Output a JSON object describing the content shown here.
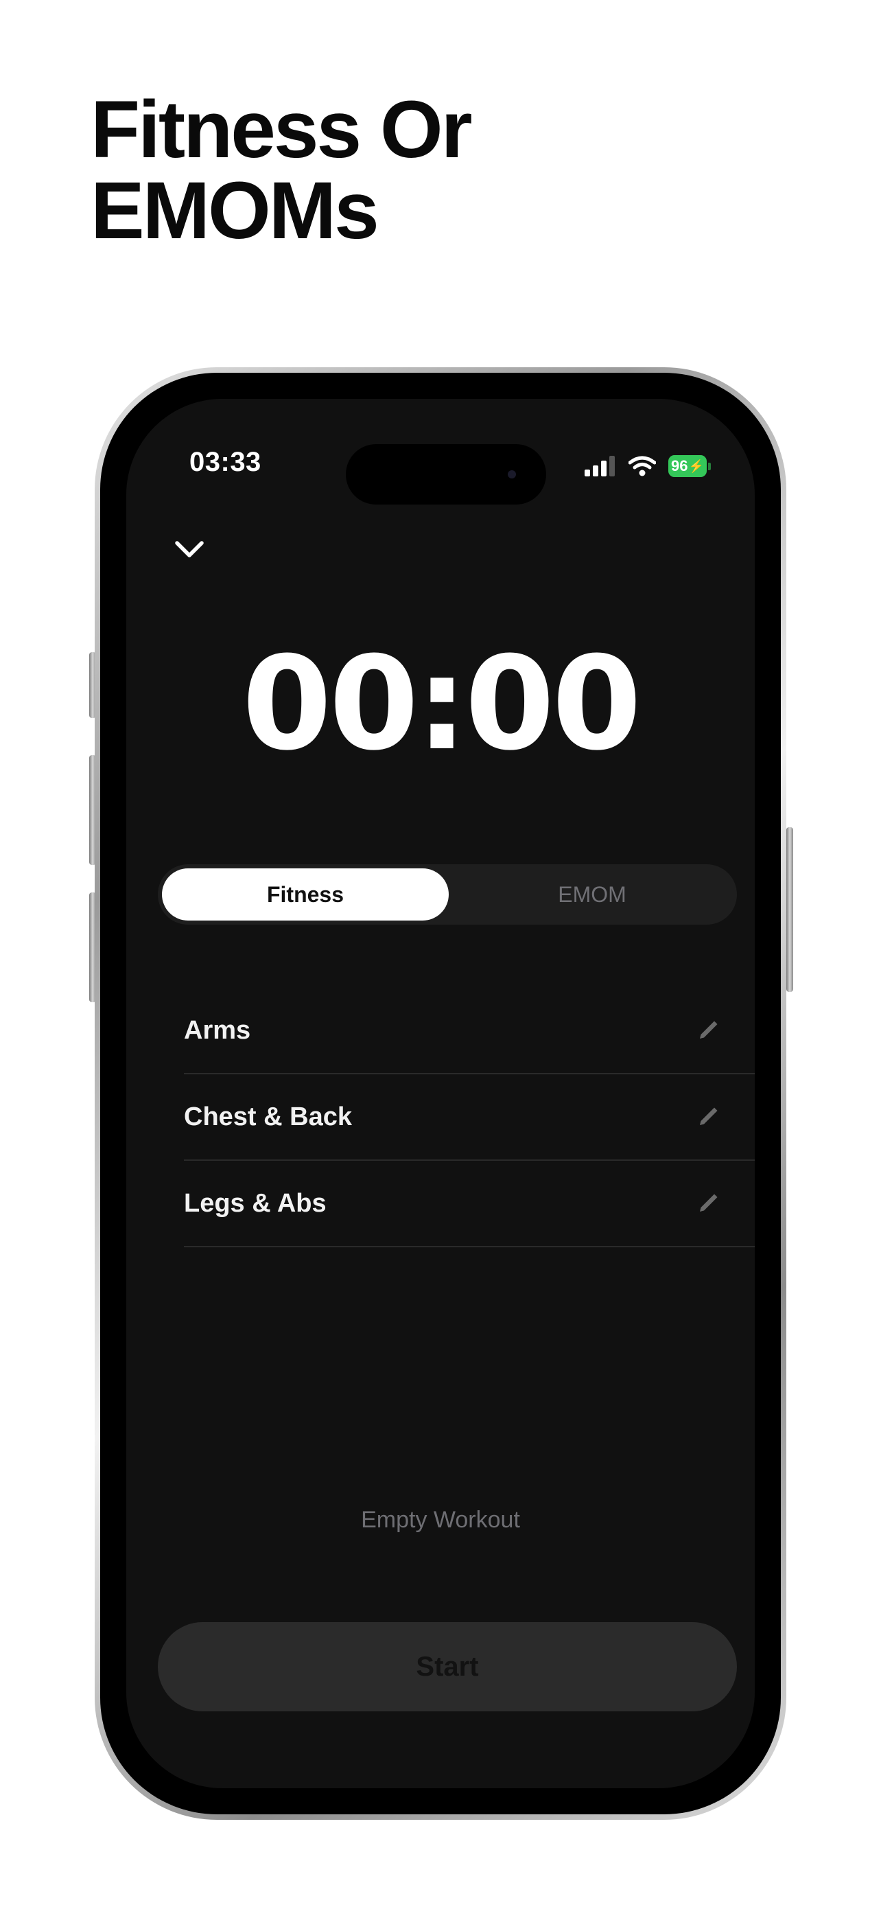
{
  "headline": {
    "line1": "Fitness Or",
    "line2": "EMOMs"
  },
  "status_bar": {
    "time": "03:33",
    "battery": "96"
  },
  "timer": {
    "display": "00:00"
  },
  "mode_tabs": [
    {
      "label": "Fitness",
      "selected": true
    },
    {
      "label": "EMOM",
      "selected": false
    }
  ],
  "workouts": [
    {
      "label": "Arms"
    },
    {
      "label": "Chest & Back"
    },
    {
      "label": "Legs & Abs"
    }
  ],
  "empty_workout_label": "Empty Workout",
  "start_label": "Start",
  "colors": {
    "screen_bg": "#111111",
    "battery_green": "#34c759",
    "segment_bg": "#1e1e1e",
    "start_bg": "#2b2b2b"
  },
  "icons": {
    "close": "chevron-down-icon",
    "edit": "pencil-icon",
    "signal": "cellular-signal-icon",
    "wifi": "wifi-icon",
    "battery": "battery-charging-icon"
  }
}
